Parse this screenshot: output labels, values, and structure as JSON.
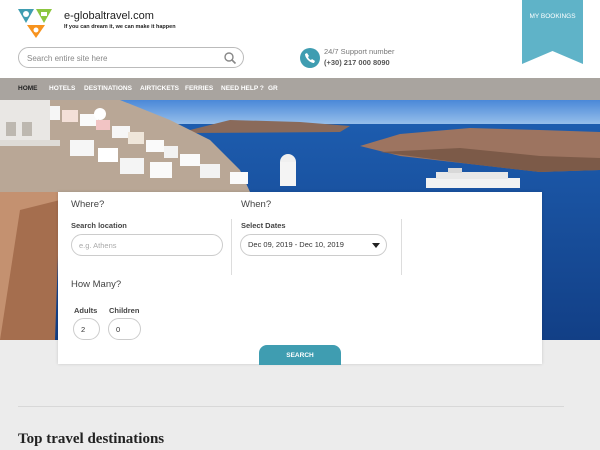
{
  "header": {
    "brand_name": "e-globaltravel.com",
    "tagline": "If you can dream it, we can make it happen",
    "search": {
      "placeholder": "Search entire site here"
    },
    "support": {
      "label": "24/7 Support number",
      "phone": "(+30) 217 000 8090"
    },
    "my_bookings_label": "MY BOOKINGS"
  },
  "nav": {
    "items": [
      {
        "label": "HOME",
        "active": true
      },
      {
        "label": "HOTELS"
      },
      {
        "label": "DESTINATIONS"
      },
      {
        "label": "AIRTICKETS"
      },
      {
        "label": "FERRIES"
      },
      {
        "label": "NEED HELP ?"
      },
      {
        "label": "GR"
      }
    ]
  },
  "booking": {
    "where": {
      "title": "Where?",
      "label": "Search location",
      "placeholder": "e.g. Athens"
    },
    "when": {
      "title": "When?",
      "label": "Select Dates",
      "value": "Dec 09, 2019 - Dec 10, 2019"
    },
    "how_many": {
      "title": "How Many?",
      "adults_label": "Adults",
      "adults_value": "2",
      "children_label": "Children",
      "children_value": "0"
    },
    "search_label": "SEARCH"
  },
  "section_heading": "Top travel destinations",
  "colors": {
    "accent": "#3f9db1",
    "nav_bg": "#a9a49f",
    "sea": "#1b56a6",
    "background": "#ececec"
  },
  "icons": [
    "logo-icon",
    "search-icon",
    "phone-icon",
    "chevron-down-icon"
  ]
}
